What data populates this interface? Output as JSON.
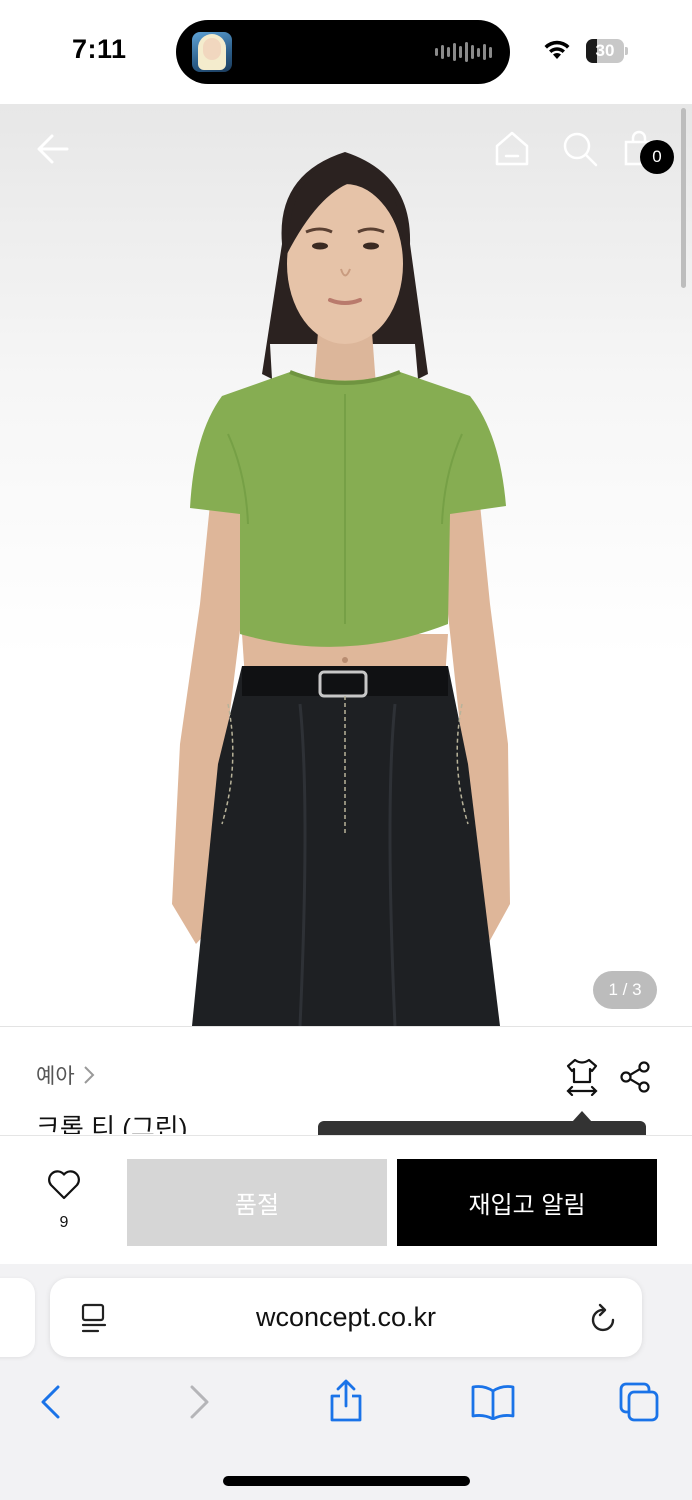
{
  "status_bar": {
    "time": "7:11",
    "battery_level": 30,
    "battery_label": "30"
  },
  "header": {
    "back_icon": "arrow-left-icon",
    "home_icon": "home-icon",
    "search_icon": "search-icon",
    "cart_icon": "shopping-bag-icon",
    "cart_count": "0"
  },
  "gallery": {
    "counter": "1 / 3"
  },
  "product": {
    "brand": "예아",
    "name": "크롭 티 (그린)",
    "size_icon": "size-guide-icon",
    "share_icon": "share-icon"
  },
  "purchase_bar": {
    "like_count": "9",
    "soldout_label": "품절",
    "restock_label": "재입고 알림"
  },
  "browser": {
    "url": "wconcept.co.kr",
    "reader_icon": "page-menu-icon",
    "reload_icon": "reload-icon",
    "toolbar_icons": [
      "back-icon",
      "forward-icon",
      "share-icon",
      "bookmarks-icon",
      "tabs-icon"
    ]
  },
  "colors": {
    "shirt": "#86ad52",
    "jeans": "#1e2023",
    "link_blue": "#1a73e8",
    "soldout_grey": "#d6d6d6",
    "restock_black": "#000000"
  }
}
